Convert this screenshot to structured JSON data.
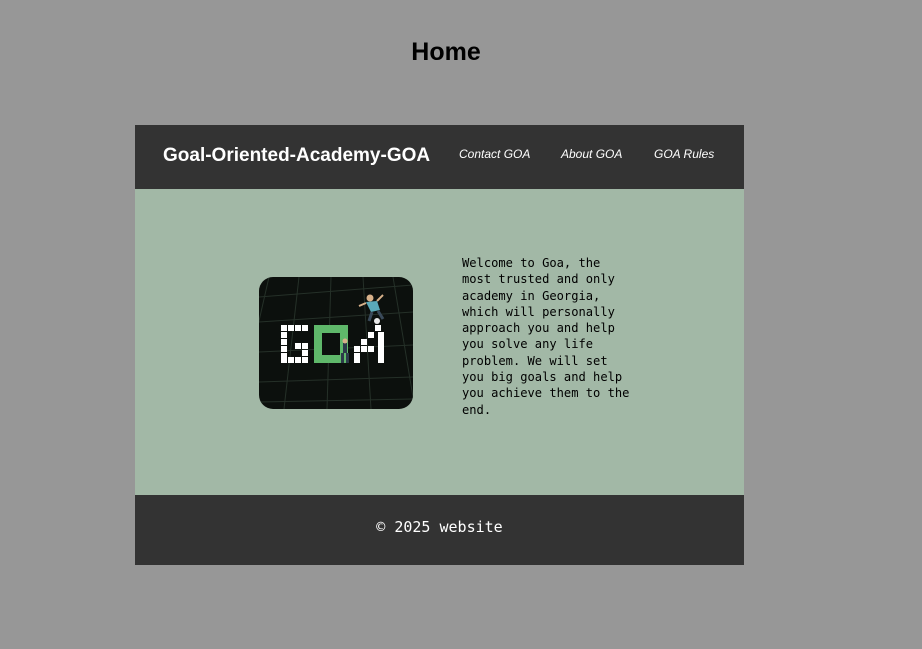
{
  "page": {
    "title": "Home"
  },
  "navbar": {
    "brand": "Goal-Oriented-Academy-GOA",
    "links": [
      {
        "label": "Contact GOA"
      },
      {
        "label": "About GOA"
      },
      {
        "label": "GOA Rules"
      }
    ]
  },
  "hero": {
    "logo_text": "GOA",
    "logo_icon": "goa-logo-icon",
    "welcome_text": "Welcome to Goa, the most trusted and only academy in Georgia, which will personally approach you and help you solve any life problem. We will set you big goals and help you achieve them to the end."
  },
  "footer": {
    "copyright": "© 2025 website"
  },
  "colors": {
    "page_background": "#979797",
    "header_background": "#333333",
    "content_background": "#a2b8a6",
    "logo_accent": "#5fb86a"
  }
}
